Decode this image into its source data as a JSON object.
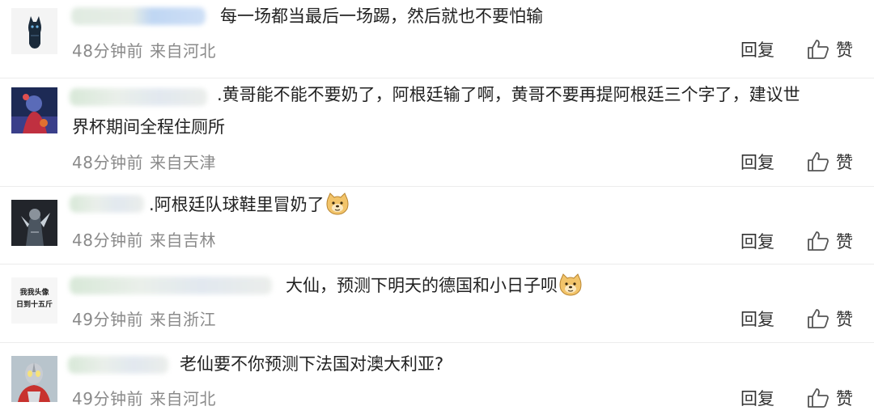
{
  "comments": [
    {
      "text": "每一场都当最后一场踢，然后就也不要怕输",
      "time": "48分钟前",
      "location": "来自河北",
      "reply_label": "回复",
      "like_label": "赞",
      "emoji": "",
      "avatar_icon": "cat-avatar-icon"
    },
    {
      "text_line1": ".黄哥能不能不要奶了，阿根廷输了啊，黄哥不要再提阿根廷三个字了，建议世",
      "text_line2": "界杯期间全程住厕所",
      "time": "48分钟前",
      "location": "来自天津",
      "reply_label": "回复",
      "like_label": "赞",
      "emoji": "",
      "avatar_icon": "anime-avatar-icon"
    },
    {
      "text": ".阿根廷队球鞋里冒奶了",
      "time": "48分钟前",
      "location": "来自吉林",
      "reply_label": "回复",
      "like_label": "赞",
      "emoji": "doge-emoji-icon",
      "avatar_icon": "dark-character-avatar-icon"
    },
    {
      "text": "大仙，预测下明天的德国和小日子呗",
      "time": "49分钟前",
      "location": "来自浙江",
      "reply_label": "回复",
      "like_label": "赞",
      "emoji": "doge-emoji-icon",
      "avatar_icon": "text-avatar-icon",
      "avatar_text_line1": "我我头像",
      "avatar_text_line2": "日到十五斤"
    },
    {
      "text": "老仙要不你预测下法国对澳大利亚?",
      "time": "49分钟前",
      "location": "来自河北",
      "reply_label": "回复",
      "like_label": "赞",
      "emoji": "",
      "avatar_icon": "ultraman-avatar-icon"
    }
  ],
  "colors": {
    "meta": "#8a8a8a",
    "text": "#222222",
    "divider": "#ececec"
  }
}
